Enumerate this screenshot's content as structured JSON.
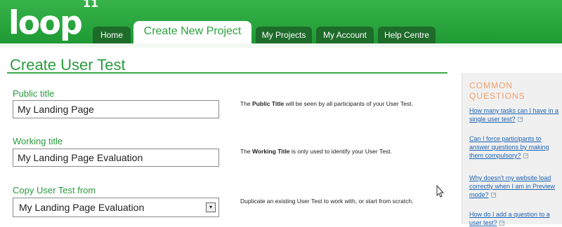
{
  "header": {
    "logo_text": "loop",
    "logo_sup": "11",
    "tabs": [
      {
        "label": "Home"
      },
      {
        "label": "Create New Project",
        "active": true
      },
      {
        "label": "My Projects"
      },
      {
        "label": "My Account"
      },
      {
        "label": "Help Centre"
      }
    ]
  },
  "page": {
    "title": "Create User Test"
  },
  "form": {
    "public_title": {
      "label": "Public title",
      "value": "My Landing Page"
    },
    "working_title": {
      "label": "Working title",
      "value": "My Landing Page Evaluation"
    },
    "copy_from": {
      "label": "Copy User Test from",
      "value": "My Landing Page Evaluation"
    }
  },
  "help": {
    "public": {
      "pre": "The ",
      "bold": "Public Title",
      "post": " will be seen by all participants of your User Test."
    },
    "working": {
      "pre": "The ",
      "bold": "Working Title",
      "post": " is only used to identify your User Test."
    },
    "copy": {
      "text": "Duplicate an existing User Test to work with, or start from scratch."
    }
  },
  "sidebar": {
    "heading": "COMMON QUESTIONS",
    "questions": [
      "How many tasks can I have in a single user test?",
      "Can I force participants to answer questions by making them compulsory?",
      "Why doesn't my website load correctly when I am in Preview mode?",
      "How do I add a question to a user test?"
    ]
  },
  "colors": {
    "brand_green": "#2aa33d",
    "tab_dark": "#1e6b2a",
    "accent_orange": "#f2a06b",
    "link_blue": "#1e63b3"
  }
}
